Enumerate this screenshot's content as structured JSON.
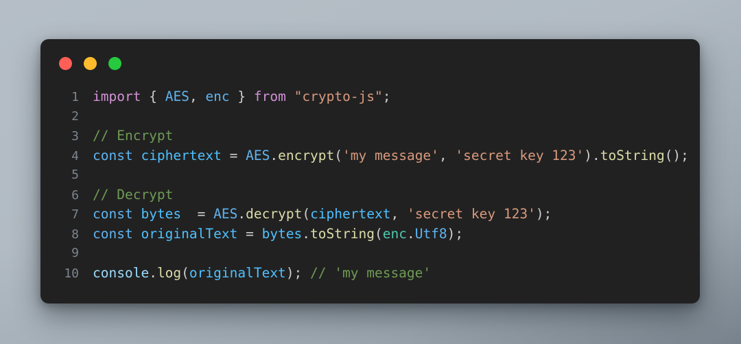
{
  "window": {
    "background_color": "#b2bbc3",
    "card_color": "#212121",
    "controls": [
      {
        "name": "close",
        "color": "#ff5f56"
      },
      {
        "name": "minimize",
        "color": "#ffbd2e"
      },
      {
        "name": "maximize",
        "color": "#27c93f"
      }
    ]
  },
  "editor": {
    "language": "javascript",
    "line_numbers": [
      "1",
      "2",
      "3",
      "4",
      "5",
      "6",
      "7",
      "8",
      "9",
      "10"
    ],
    "lines": [
      {
        "number": "1",
        "plain": "import { AES, enc } from \"crypto-js\";",
        "tokens": [
          {
            "text": "import",
            "type": "kw"
          },
          {
            "text": " ",
            "type": "punc"
          },
          {
            "text": "{",
            "type": "punc"
          },
          {
            "text": " ",
            "type": "punc"
          },
          {
            "text": "AES",
            "type": "class"
          },
          {
            "text": ",",
            "type": "punc"
          },
          {
            "text": " ",
            "type": "punc"
          },
          {
            "text": "enc",
            "type": "class"
          },
          {
            "text": " ",
            "type": "punc"
          },
          {
            "text": "}",
            "type": "punc"
          },
          {
            "text": " ",
            "type": "punc"
          },
          {
            "text": "from",
            "type": "kw"
          },
          {
            "text": " ",
            "type": "punc"
          },
          {
            "text": "\"crypto-js\"",
            "type": "str"
          },
          {
            "text": ";",
            "type": "punc"
          }
        ]
      },
      {
        "number": "2",
        "plain": "",
        "tokens": []
      },
      {
        "number": "3",
        "plain": "// Encrypt",
        "tokens": [
          {
            "text": "// Encrypt",
            "type": "com"
          }
        ]
      },
      {
        "number": "4",
        "plain": "const ciphertext = AES.encrypt('my message', 'secret key 123').toString();",
        "tokens": [
          {
            "text": "const",
            "type": "decl"
          },
          {
            "text": " ",
            "type": "punc"
          },
          {
            "text": "ciphertext",
            "type": "var"
          },
          {
            "text": " ",
            "type": "punc"
          },
          {
            "text": "=",
            "type": "op"
          },
          {
            "text": " ",
            "type": "punc"
          },
          {
            "text": "AES",
            "type": "class"
          },
          {
            "text": ".",
            "type": "punc"
          },
          {
            "text": "encrypt",
            "type": "fn"
          },
          {
            "text": "(",
            "type": "punc"
          },
          {
            "text": "'my message'",
            "type": "str"
          },
          {
            "text": ",",
            "type": "punc"
          },
          {
            "text": " ",
            "type": "punc"
          },
          {
            "text": "'secret key 123'",
            "type": "str"
          },
          {
            "text": ")",
            "type": "punc"
          },
          {
            "text": ".",
            "type": "punc"
          },
          {
            "text": "toString",
            "type": "fn"
          },
          {
            "text": "();",
            "type": "punc"
          }
        ]
      },
      {
        "number": "5",
        "plain": "",
        "tokens": []
      },
      {
        "number": "6",
        "plain": "// Decrypt",
        "tokens": [
          {
            "text": "// Decrypt",
            "type": "com"
          }
        ]
      },
      {
        "number": "7",
        "plain": "const bytes  = AES.decrypt(ciphertext, 'secret key 123');",
        "tokens": [
          {
            "text": "const",
            "type": "decl"
          },
          {
            "text": " ",
            "type": "punc"
          },
          {
            "text": "bytes",
            "type": "var"
          },
          {
            "text": "  ",
            "type": "punc"
          },
          {
            "text": "=",
            "type": "op"
          },
          {
            "text": " ",
            "type": "punc"
          },
          {
            "text": "AES",
            "type": "class"
          },
          {
            "text": ".",
            "type": "punc"
          },
          {
            "text": "decrypt",
            "type": "fn"
          },
          {
            "text": "(",
            "type": "punc"
          },
          {
            "text": "ciphertext",
            "type": "var"
          },
          {
            "text": ",",
            "type": "punc"
          },
          {
            "text": " ",
            "type": "punc"
          },
          {
            "text": "'secret key 123'",
            "type": "str"
          },
          {
            "text": ");",
            "type": "punc"
          }
        ]
      },
      {
        "number": "8",
        "plain": "const originalText = bytes.toString(enc.Utf8);",
        "tokens": [
          {
            "text": "const",
            "type": "decl"
          },
          {
            "text": " ",
            "type": "punc"
          },
          {
            "text": "originalText",
            "type": "var"
          },
          {
            "text": " ",
            "type": "punc"
          },
          {
            "text": "=",
            "type": "op"
          },
          {
            "text": " ",
            "type": "punc"
          },
          {
            "text": "bytes",
            "type": "var"
          },
          {
            "text": ".",
            "type": "punc"
          },
          {
            "text": "toString",
            "type": "fn"
          },
          {
            "text": "(",
            "type": "punc"
          },
          {
            "text": "enc",
            "type": "ns"
          },
          {
            "text": ".",
            "type": "punc"
          },
          {
            "text": "Utf8",
            "type": "class"
          },
          {
            "text": ");",
            "type": "punc"
          }
        ]
      },
      {
        "number": "9",
        "plain": "",
        "tokens": []
      },
      {
        "number": "10",
        "plain": "console.log(originalText); // 'my message'",
        "tokens": [
          {
            "text": "console",
            "type": "obj"
          },
          {
            "text": ".",
            "type": "punc"
          },
          {
            "text": "log",
            "type": "fn"
          },
          {
            "text": "(",
            "type": "punc"
          },
          {
            "text": "originalText",
            "type": "var"
          },
          {
            "text": ");",
            "type": "punc"
          },
          {
            "text": " ",
            "type": "punc"
          },
          {
            "text": "// 'my message'",
            "type": "com"
          }
        ]
      }
    ],
    "token_colors": {
      "kw": "#d291d6",
      "decl": "#60b4f0",
      "var": "#4fc1ff",
      "class": "#60b4f0",
      "ns": "#4ec9b0",
      "fn": "#dcdcaa",
      "str": "#d99a7e",
      "com": "#6f9b55",
      "punc": "#cfcfcf",
      "op": "#cfcfcf",
      "obj": "#9cdcfe",
      "line_number": "#7d8590"
    }
  }
}
